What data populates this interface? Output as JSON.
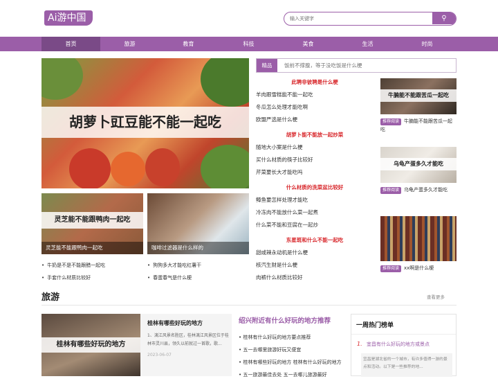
{
  "header": {
    "logo": "Ai游中国",
    "search_placeholder": "输入关键字",
    "search_icon": "search-icon"
  },
  "nav": [
    "首页",
    "旅游",
    "教育",
    "科技",
    "美食",
    "生活",
    "时尚"
  ],
  "colors": {
    "accent": "#9b5ea8",
    "headline_red": "#d8282c"
  },
  "hero": {
    "banner": "胡萝卜豇豆能不能一起吃"
  },
  "thumbs": [
    {
      "band": "灵芝能不能跟鸭肉一起吃",
      "caption": "灵芝能不能跟鸭肉一起吃"
    },
    {
      "band": "",
      "caption": "咖啡过滤器是什么样的"
    }
  ],
  "bottom_left": [
    "牛奶是不是不能跟醋一起吃",
    "手套什么材质比较好"
  ],
  "bottom_right": [
    "狗狗多大才能吃红薯干",
    "春蛋春气是什么梗"
  ],
  "tabs": {
    "label": "精品",
    "tip": "饭前不撑腹，等于没吃饭是什么梗"
  },
  "mid_groups": [
    {
      "head": "此聘非彼聘是什么梗",
      "items": [
        "羊肉跟雪糕能不能一起吃",
        "冬瓜怎么处理才能吃啊",
        "欧盟严选是什么梗"
      ]
    },
    {
      "head": "胡萝卜能不能放一起炒菜",
      "items": [
        "随地大小案是什么梗",
        "买什么材质的筷子比较好",
        "芹菜要长大才能吃吗"
      ]
    },
    {
      "head": "什么材质的洗菜盆比较好",
      "items": [
        "鳟鱼要怎样处理才能吃",
        "冷冻肉不能放什么菜一起煮",
        "什么菜不能和豆腐在一起炒"
      ]
    },
    {
      "head": "东星斑和什么不能一起吃",
      "items": [
        "甜咸辣永动机是什么梗",
        "核汽生财是什么梗",
        "肉裤什么材质比较好"
      ]
    }
  ],
  "right_cards": [
    {
      "band": "牛腩能不能跟苦瓜一起吃",
      "tag": "推荐阅读",
      "text": "牛腩能不能跟苦瓜一起吃"
    },
    {
      "band": "乌龟产蛋多久才能吃",
      "tag": "推荐阅读",
      "text": "乌龟产蛋多久才能吃"
    },
    {
      "band": "",
      "tag": "推荐阅读",
      "text": "xx啊是什么梗"
    }
  ],
  "travel": {
    "title": "旅游",
    "more": "查看更多",
    "card": {
      "band": "桂林有哪些好玩的地方",
      "title": "桂林有哪些好玩的地方",
      "desc": "1、漓江风景名胜区，桂林漓江风景区位于桂林市灵川县，领久以前就过一首歌，歌...",
      "date": "2023-06-07"
    },
    "list_head": "绍兴附近有什么好玩的地方推荐",
    "list": [
      "桂林有什么好玩的地方要点推荐",
      "五一去哪里旅游好玩又便宜",
      "桂林有哪些好玩的地方 桂林有什么好玩的地方",
      "五一旅游最佳去处 五一去哪儿旅游最好"
    ],
    "hot": {
      "title": "一周热门榜单",
      "num": "1.",
      "item": "宜昌有什么好玩的地方或景点",
      "desc": "宜昌是湖北省的一个城市，有许多值得一游的景点和活动。以下是一些推荐的地..."
    }
  }
}
